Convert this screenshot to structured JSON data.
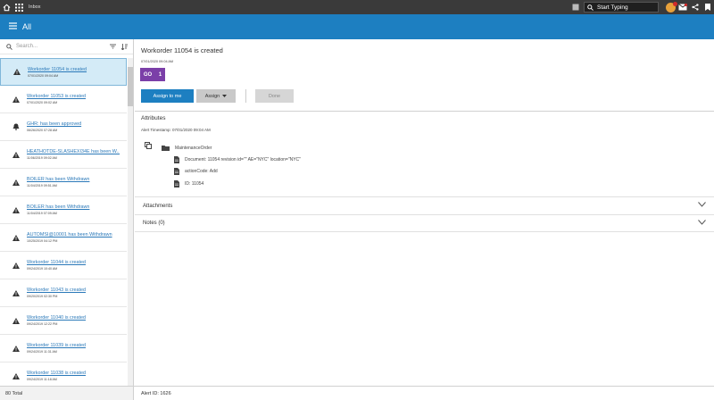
{
  "topbar": {
    "app_title": "Inbox",
    "search_placeholder": "Start Typing"
  },
  "header": {
    "title": "All"
  },
  "list": {
    "search_placeholder": "Search...",
    "items": [
      {
        "title": "Workorder 11054 is created",
        "time": "07/01/2020 09:04 AM",
        "icon": "warning-icon",
        "selected": true
      },
      {
        "title": "Workorder 11053 is created",
        "time": "07/01/2020 09:02 AM",
        "icon": "warning-icon"
      },
      {
        "title": "GHR: has been approved",
        "time": "06/26/2020 07:28 AM",
        "icon": "bell-icon"
      },
      {
        "title": "HEATHOTDE-SLASHEXI34E has been W...",
        "time": "11/06/2019 09:02 AM",
        "icon": "warning-icon"
      },
      {
        "title": "BOILER has been Withdrawn",
        "time": "11/04/2019 09:51 AM",
        "icon": "warning-icon"
      },
      {
        "title": "BOILER has been Withdrawn",
        "time": "11/04/2019 07:09 AM",
        "icon": "warning-icon"
      },
      {
        "title": "AUTOMSI@10001 has been Withdrawn",
        "time": "10/25/2019 04:12 PM",
        "icon": "warning-icon"
      },
      {
        "title": "Workorder 11044 is created",
        "time": "09/24/2019 10:40 AM",
        "icon": "warning-icon"
      },
      {
        "title": "Workorder 11043 is created",
        "time": "09/20/2019 02:30 PM",
        "icon": "warning-icon"
      },
      {
        "title": "Workorder 11040 is created",
        "time": "09/24/2019 12:22 PM",
        "icon": "warning-icon"
      },
      {
        "title": "Workorder 11039 is created",
        "time": "09/24/2019 11:31 AM",
        "icon": "warning-icon"
      },
      {
        "title": "Workorder 11038 is created",
        "time": "09/24/2019 11:18 AM",
        "icon": "warning-icon"
      }
    ]
  },
  "detail": {
    "title": "Workorder 11054 is created",
    "date": "07/01/2020 09:04 AM",
    "badge_label": "GO",
    "badge_count": "1",
    "assign_me_label": "Assign to me",
    "assign_label": "Assign",
    "done_label": "Done",
    "attributes_heading": "Attributes",
    "alert_timestamp": "Alert Timestamp: 07/01/2020 09:04 AM",
    "tree": {
      "root": "MaintenanceOrder",
      "children": [
        "Document: 11054 revision id=\"\" AE=\"NYC\" location=\"NYC\"",
        "actionCode: Add",
        "ID: 11054"
      ]
    },
    "attachments_label": "Attachments",
    "notes_label": "Notes (0)"
  },
  "footer": {
    "total": "80 Total",
    "alert_id": "Alert ID: 1626"
  },
  "colors": {
    "header_blue": "#1d7fc1",
    "badge_purple": "#7b3fa8",
    "topbar": "#3a3a3a"
  }
}
